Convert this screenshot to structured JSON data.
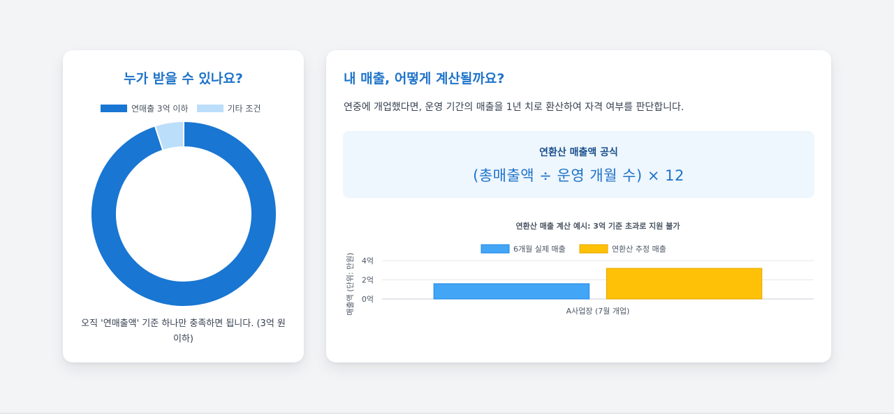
{
  "left_card": {
    "title": "누가 받을 수 있나요?",
    "caption": "오직 '연매출액' 기준 하나만 충족하면 됩니다. (3억 원 이하)"
  },
  "right_card": {
    "title": "내 매출, 어떻게 계산될까요?",
    "description": "연중에 개업했다면, 운영 기간의 매출을 1년 치로 환산하여 자격 여부를 판단합니다.",
    "formula_label": "연환산 매출액 공식",
    "formula": "(총매출액 ÷ 운영 개월 수) × 12"
  },
  "colors": {
    "primary": "#1976d2",
    "light": "#bbdefb",
    "bar_actual": "#42a5f5",
    "bar_annual": "#ffc107",
    "title": "#1e73c9"
  },
  "chart_data": [
    {
      "type": "pie",
      "style": "donut",
      "categories": [
        "연매출 3억 이하",
        "기타 조건"
      ],
      "values": [
        95,
        5
      ],
      "legend_position": "top"
    },
    {
      "type": "bar",
      "title": "연환산 매출 계산 예시: 3억 기준 초과로 지원 불가",
      "categories": [
        "A사업장 (7월 개업)"
      ],
      "series": [
        {
          "name": "6개월 실제 매출",
          "values": [
            1.6
          ]
        },
        {
          "name": "연환산 추정 매출",
          "values": [
            3.2
          ]
        }
      ],
      "ylabel": "매출액 (단위: 만원)",
      "xlabel": "",
      "y_ticks": [
        "0억",
        "2억",
        "4억"
      ],
      "ylim": [
        0,
        4
      ],
      "grid": true,
      "legend_position": "top"
    }
  ]
}
